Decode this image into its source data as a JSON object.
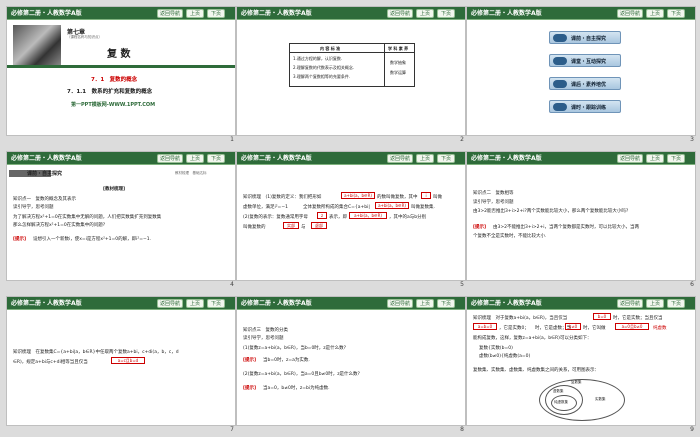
{
  "header": {
    "title": "必修第二册・人教数学A版",
    "nav_back": "返回导航",
    "prev": "上页",
    "next": "下页"
  },
  "slides": [
    {
      "number": "1",
      "chapter": "第七章",
      "chapter_sub": "（课程名称与知识点）",
      "main_title": "复 数",
      "sec1": "7．1　复数的概念",
      "sec2": "7．1.1　数系的扩充和复数的概念",
      "site": "第一PPT模板网-WWW.1PPT.COM"
    },
    {
      "number": "2",
      "col1_head": "内 容 标 准",
      "col2_head": "学 科 素 养",
      "rows": [
        "1.通过方程的解，认识复数.",
        "2.理解复数的代数表示及相关概念.",
        "3.理解两个复数相等的充要条件."
      ],
      "traits": [
        "数学抽象",
        "数学运算"
      ]
    },
    {
      "number": "3",
      "nav": [
        "课前・自主探究",
        "课堂・互动探究",
        "课后・素养培优",
        "课时・跟踪训练"
      ]
    },
    {
      "number": "4",
      "tag": "课前・自主探究",
      "tag_right": "教材梳理　基础达标",
      "heading": "[教材梳理]",
      "lines": [
        "知识点一　复数的概念及其表示",
        "读引导学，思考问题",
        "为了解决方程x²+1=0在实数集中无解的问题，人们把实数集扩充到复数集",
        "那么怎样解决方程x²+1=0在实数集中的问题?"
      ],
      "hint": "[提示]",
      "hint_text": "设想引入一个新数i，使x=i是方程x²+1=0的解，即i²=−1."
    },
    {
      "number": "5",
      "lines": [
        "知识梳理　(1)复数的定义：我们把形如",
        "虚数单位，满足i²=−1",
        "(2)复数的表示：复数通常用字母",
        "叫做复数的"
      ],
      "box1": "a+bi(a，b∈R)",
      "box2": "z",
      "box3": "a+bi(a，b∈R)",
      "box4": "实部",
      "box5": "虚部",
      "mid1": "的数叫做复数，其中",
      "mid2": "全体复数所构成的集合C={a+bi|",
      "mid3": "叫做复数集.",
      "mid4": "表示，即",
      "mid5": "，其中的a与b分别",
      "mid6": "与",
      "unit": "i",
      "unit_tail": "叫做"
    },
    {
      "number": "6",
      "lines": [
        "知识点二　复数相等",
        "读引导学，思考问题",
        "由3>2能否推出3+i>2+i?两个实数能比较大小，那么两个复数能比较大小吗?"
      ],
      "hint": "[提示]",
      "hint_text": "由3>2不能推出3+i>2+i，当两个复数都是实数时，可以比较大小，当两",
      "hint_text2": "个复数不全是实数时，不能比较大小."
    },
    {
      "number": "7",
      "line1": "知识梳理　在复数集C={a+bi|a，b∈R}中任取两个复数a+bi，c+di(a，b，c，d",
      "line2": "∈R)，规定a+bi与c+di相等当且仅当",
      "box": "a=c且b=d"
    },
    {
      "number": "8",
      "lines": [
        "知识点三　复数的分类",
        "读引导学，思考问题",
        "(1)复数z=a+bi(a，b∈R)，当b=0时，z是什么数?",
        "(2)复数z=a+bi(a，b∈R)，当a=0且b≠0时，z是什么数?"
      ],
      "hint1": "[提示]",
      "hint1_text": "当b=0时，z=a为实数.",
      "hint2": "[提示]",
      "hint2_text": "当a=0，b≠0时，z=bi为纯虚数."
    },
    {
      "number": "9",
      "lines": [
        "知识梳理　对于复数a+bi(a，b∈R)，当且仅当",
        "时，它是实数；当且仅当",
        "时，它是虚数；当",
        "时，它叫做",
        "能构成复数，这样，复数z=a+bi(a，b∈R)可以分类如下：",
        "复数集、实数集、虚数集、纯虚数集之间的关系，可用图表示："
      ],
      "boxes": [
        "b=0",
        "a=b=0",
        "b≠0",
        "a=0且b≠0"
      ],
      "tail1": "，它是实数0；",
      "tail2": "纯虚数",
      "class1": "复数{实数(b=0)",
      "class2": "虚数(b≠0){纯虚数(a=0)",
      "venn_outer": "复数集",
      "venn_real": "实数集",
      "venn_imag": "虚数集",
      "venn_pure": "纯虚数集"
    }
  ]
}
